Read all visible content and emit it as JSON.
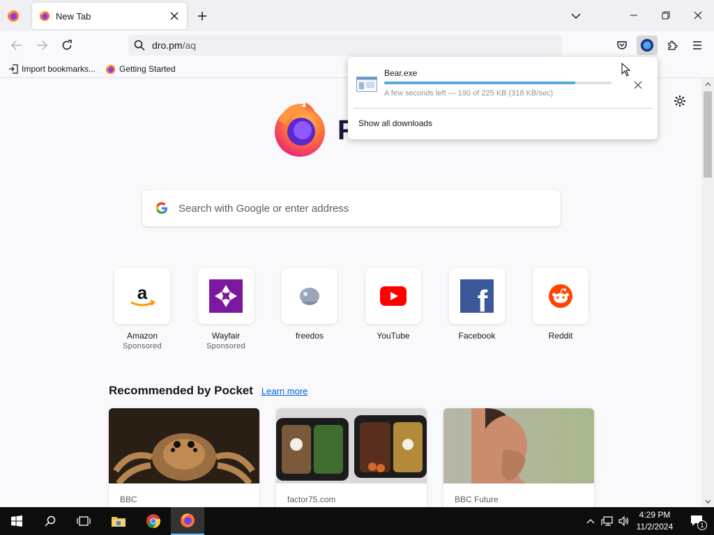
{
  "browser": {
    "tab": {
      "title": "New Tab"
    },
    "url": {
      "host": "dro.pm",
      "path": "/aq"
    },
    "bookmarks": [
      {
        "label": "Import bookmarks..."
      },
      {
        "label": "Getting Started"
      }
    ]
  },
  "downloads_panel": {
    "file_name": "Bear.exe",
    "status": "A few seconds left — 190 of 225 KB (318 KB/sec)",
    "progress": 0.84,
    "show_all_label": "Show all downloads"
  },
  "newtab": {
    "wordmark": "F",
    "search_placeholder": "Search with Google or enter address",
    "top_sites": [
      {
        "name": "Amazon",
        "sponsored": "Sponsored",
        "icon": "amazon-icon"
      },
      {
        "name": "Wayfair",
        "sponsored": "Sponsored",
        "icon": "wayfair-icon"
      },
      {
        "name": "freedos",
        "sponsored": "",
        "icon": "freedos-icon"
      },
      {
        "name": "YouTube",
        "sponsored": "",
        "icon": "youtube-icon"
      },
      {
        "name": "Facebook",
        "sponsored": "",
        "icon": "facebook-icon"
      },
      {
        "name": "Reddit",
        "sponsored": "",
        "icon": "reddit-icon"
      }
    ],
    "pocket": {
      "title": "Recommended by Pocket",
      "learn_more": "Learn more",
      "cards": [
        {
          "source": "BBC"
        },
        {
          "source": "factor75.com"
        },
        {
          "source": "BBC Future"
        }
      ]
    }
  },
  "taskbar": {
    "time": "4:29 PM",
    "date": "11/2/2024",
    "notification_count": "1"
  },
  "colors": {
    "accent": "#0060df",
    "progress": "#5aa8e0",
    "taskbar": "#0d0d0d"
  }
}
